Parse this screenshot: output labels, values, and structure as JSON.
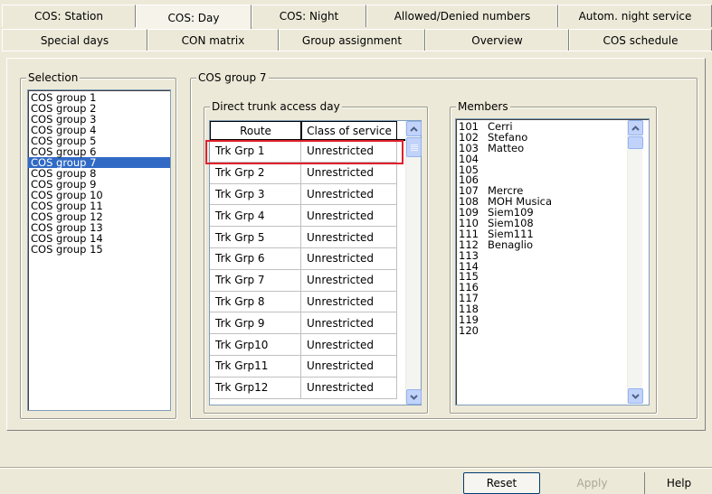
{
  "tabs": {
    "row1": [
      {
        "label": "COS: Station",
        "active": false
      },
      {
        "label": "COS: Day",
        "active": true
      },
      {
        "label": "COS: Night",
        "active": false
      },
      {
        "label": "Allowed/Denied numbers",
        "active": false
      },
      {
        "label": "Autom. night service",
        "active": false
      }
    ],
    "row2": [
      {
        "label": "Special days"
      },
      {
        "label": "CON matrix"
      },
      {
        "label": "Group assignment"
      },
      {
        "label": "Overview"
      },
      {
        "label": "COS schedule"
      }
    ]
  },
  "selection": {
    "legend": "Selection",
    "items": [
      "COS group 1",
      "COS group 2",
      "COS group 3",
      "COS group 4",
      "COS group 5",
      "COS group 6",
      "COS group 7",
      "COS group 8",
      "COS group 9",
      "COS group 10",
      "COS group 11",
      "COS group 12",
      "COS group 13",
      "COS group 14",
      "COS group 15"
    ],
    "selected_index": 6
  },
  "cos_group": {
    "legend": "COS group 7",
    "direct_trunk": {
      "legend": "Direct trunk access day",
      "columns": [
        "Route",
        "Class of service"
      ],
      "rows": [
        [
          "Trk Grp 1",
          "Unrestricted"
        ],
        [
          "Trk Grp 2",
          "Unrestricted"
        ],
        [
          "Trk Grp 3",
          "Unrestricted"
        ],
        [
          "Trk Grp 4",
          "Unrestricted"
        ],
        [
          "Trk Grp 5",
          "Unrestricted"
        ],
        [
          "Trk Grp 6",
          "Unrestricted"
        ],
        [
          "Trk Grp 7",
          "Unrestricted"
        ],
        [
          "Trk Grp 8",
          "Unrestricted"
        ],
        [
          "Trk Grp 9",
          "Unrestricted"
        ],
        [
          "Trk Grp10",
          "Unrestricted"
        ],
        [
          "Trk Grp11",
          "Unrestricted"
        ],
        [
          "Trk Grp12",
          "Unrestricted"
        ]
      ],
      "highlighted_row": 0
    },
    "members": {
      "legend": "Members",
      "rows": [
        [
          "101",
          "Cerri"
        ],
        [
          "102",
          "Stefano"
        ],
        [
          "103",
          "Matteo"
        ],
        [
          "104",
          ""
        ],
        [
          "105",
          ""
        ],
        [
          "106",
          ""
        ],
        [
          "107",
          "Mercre"
        ],
        [
          "108",
          "MOH Musica"
        ],
        [
          "109",
          "Siem109"
        ],
        [
          "110",
          "Siem108"
        ],
        [
          "111",
          "Siem111"
        ],
        [
          "112",
          "Benaglio"
        ],
        [
          "113",
          ""
        ],
        [
          "114",
          ""
        ],
        [
          "115",
          ""
        ],
        [
          "116",
          ""
        ],
        [
          "117",
          ""
        ],
        [
          "118",
          ""
        ],
        [
          "119",
          ""
        ],
        [
          "120",
          ""
        ]
      ]
    }
  },
  "buttons": {
    "reset": "Reset",
    "apply": "Apply",
    "help": "Help"
  },
  "colors": {
    "selection_bg": "#316ac5",
    "highlight_border": "#e0202a",
    "window_bg": "#ece9d8"
  }
}
